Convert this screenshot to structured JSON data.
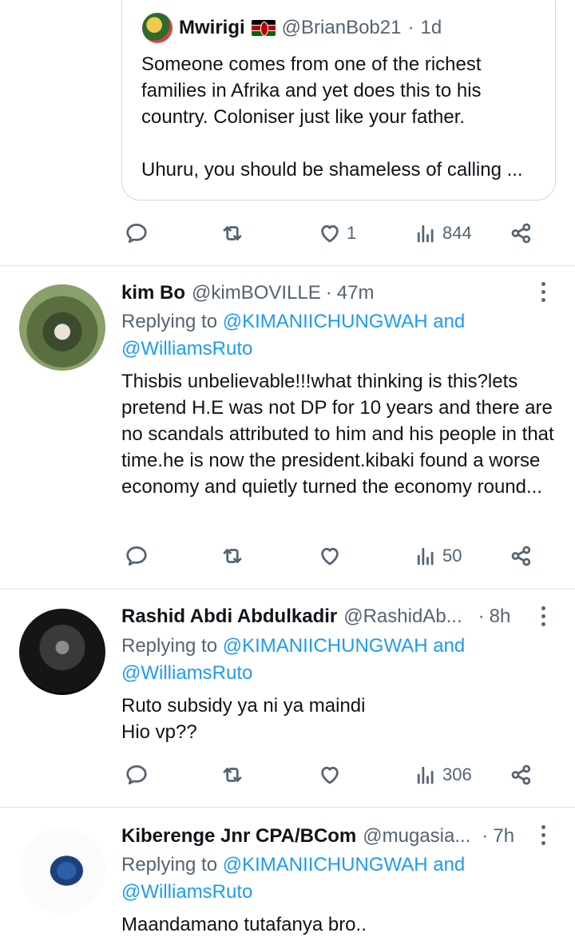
{
  "quoted": {
    "name": "Mwirigi",
    "handle": "@BrianBob21",
    "time": "1d",
    "text": "Someone comes from one of the richest families in Afrika and yet does this to his country. Coloniser just like your father.\n\nUhuru, you should be shameless of calling ..."
  },
  "main_actions": {
    "likes": "1",
    "views": "844"
  },
  "replies": [
    {
      "name": "kim Bo",
      "handle": "@kimBOVILLE",
      "time": "47m",
      "replying_prefix": "Replying to ",
      "mention1": "@KIMANIICHUNGWAH",
      "and": " and",
      "mention2": "@WilliamsRuto",
      "text": "Thisbis unbelievable!!!what thinking is this?lets pretend H.E was not DP for 10 years and there are no scandals attributed to him and his people in that time.he is now the president.kibaki found a worse economy and quietly turned the economy round...",
      "views": "50"
    },
    {
      "name": "Rashid Abdi Abdulkadir",
      "handle": "@RashidAb...",
      "time": "8h",
      "replying_prefix": "Replying to ",
      "mention1": "@KIMANIICHUNGWAH",
      "and": " and",
      "mention2": "@WilliamsRuto",
      "text": "Ruto subsidy ya ni ya maindi\nHio vp??",
      "views": "306"
    },
    {
      "name": "Kiberenge Jnr CPA/BCom",
      "handle": "@mugasia...",
      "time": "7h",
      "replying_prefix": "Replying to ",
      "mention1": "@KIMANIICHUNGWAH",
      "and": " and",
      "mention2": "@WilliamsRuto",
      "text": "Maandamano tutafanya bro.."
    }
  ],
  "colors": {
    "link": "#1d9bf0",
    "muted": "#536471",
    "border": "#cfd9de"
  },
  "icons": [
    "reply-icon",
    "retweet-icon",
    "like-icon",
    "views-icon",
    "share-icon",
    "more-icon",
    "kenya-flag-icon"
  ]
}
